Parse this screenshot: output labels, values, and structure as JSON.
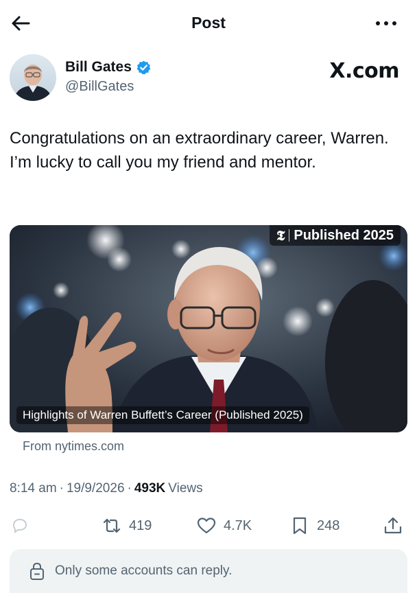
{
  "topbar": {
    "title": "Post",
    "back_icon": "arrow-left-icon",
    "more_icon": "more-horizontal-icon"
  },
  "author": {
    "name": "Bill Gates",
    "handle": "@BillGates",
    "verified_icon": "verified-badge-icon",
    "verified_color": "#1d9bf0"
  },
  "source_logo": "X.com",
  "post": {
    "text": "Congratulations on an extraordinary career, Warren. I’m lucky to call you my friend and mentor."
  },
  "card": {
    "badge_logo": "𝕿",
    "badge_text": "Published 2025",
    "caption": "Highlights of Warren Buffett’s Career (Published 2025)",
    "from": "From nytimes.com"
  },
  "meta": {
    "time": "8:14 am",
    "date": "19/9/2026",
    "views_count": "493K",
    "views_label": "Views",
    "separator": "·"
  },
  "actions": {
    "reply_icon": "reply-icon",
    "repost_count": "419",
    "like_count": "4.7K",
    "bookmark_count": "248",
    "share_icon": "share-icon"
  },
  "reply_restriction": {
    "text": "Only some accounts can reply.",
    "icon": "lock-icon"
  },
  "colors": {
    "text_primary": "#0f1419",
    "text_secondary": "#536471",
    "accent": "#1d9bf0",
    "reply_bar_bg": "#eff3f4"
  }
}
